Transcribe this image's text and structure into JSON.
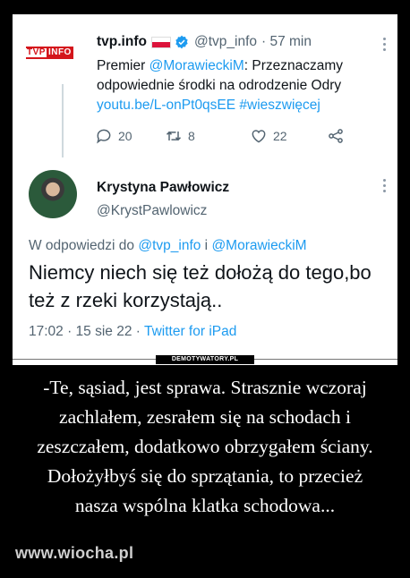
{
  "tweet": {
    "logo": {
      "left": "TVP",
      "right": "INFO"
    },
    "name": "tvp.info",
    "handle": "@tvp_info",
    "time": "· 57 min",
    "body_lead": "Premier ",
    "body_mention": "@MorawieckiM",
    "body_text": ": Przeznaczamy odpowiednie środki na odrodzenie Odry",
    "body_link": "youtu.be/L-onPt0qsEE",
    "body_hashtag": "#wieszwięcej",
    "replies": "20",
    "retweets": "8",
    "likes": "22"
  },
  "reply": {
    "name": "Krystyna Pawłowicz",
    "handle": "@KrystPawlowicz",
    "reply_prefix": "W odpowiedzi do ",
    "reply_user1": "@tvp_info",
    "reply_and": " i ",
    "reply_user2": "@MorawieckiM",
    "body": "Niemcy niech się też dołożą do tego,bo też z rzeki korzystają..",
    "datetime": "17:02 · 15 sie 22 · ",
    "client": "Twitter for iPad"
  },
  "watermark": "DEMOTYWATORY.PL",
  "caption": "-Te, sąsiad, jest sprawa. Strasznie wczoraj zachlałem, zesrałem się na schodach i zeszczałem, dodatkowo obrzygałem ściany. Dołożyłbyś się do sprzątania, to przecież nasza wspólna klatka schodowa...",
  "site": "www.wiocha.pl",
  "colors": {
    "accent": "#1d9bf0",
    "tvp_red": "#d4151b",
    "text": "#0f1419",
    "muted": "#536471"
  }
}
